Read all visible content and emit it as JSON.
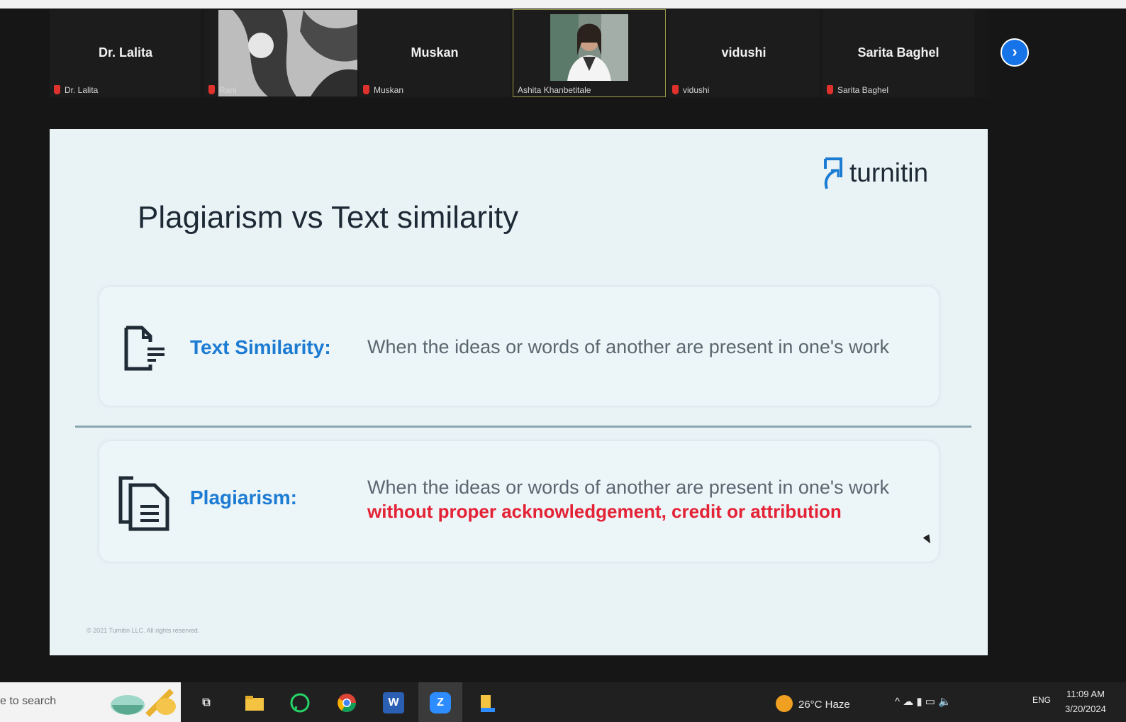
{
  "gallery": {
    "tiles": [
      {
        "name": "Dr. Lalita",
        "label": "Dr. Lalita"
      },
      {
        "name": "",
        "label": "Rani"
      },
      {
        "name": "Muskan",
        "label": "Muskan"
      },
      {
        "name": "",
        "label": "Ashita Khanbetitale"
      },
      {
        "name": "vidushi",
        "label": "vidushi"
      },
      {
        "name": "Sarita Baghel",
        "label": "Sarita Baghel"
      }
    ],
    "next_icon": "chevron-right-icon"
  },
  "slide": {
    "title": "Plagiarism vs Text similarity",
    "brand": "turnitin",
    "text_similarity": {
      "term": "Text Similarity:",
      "definition": "When the ideas or words of another are present in one's work"
    },
    "plagiarism": {
      "term": "Plagiarism:",
      "definition": "When the ideas or words of another are present in one's work",
      "emphasis": "without proper acknowledgement, credit or attribution"
    },
    "copyright": "© 2021 Turnitin LLC. All rights reserved."
  },
  "taskbar": {
    "search_placeholder": "e to search",
    "weather": "26°C Haze",
    "language": "ENG",
    "time": "11:09 AM",
    "date": "3/20/2024"
  },
  "colors": {
    "accent_blue": "#1c7bd2",
    "emphasis_red": "#e42235",
    "zoom_blue": "#1674e8",
    "slide_bg": "#e9f3f6"
  }
}
